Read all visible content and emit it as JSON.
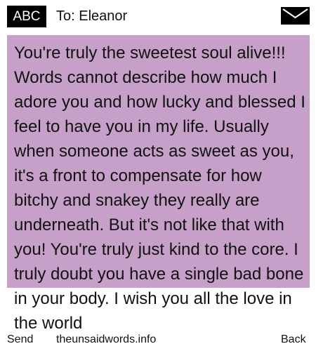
{
  "header": {
    "mode_badge": "ABC",
    "recipient_label": "To: Eleanor",
    "icon": "envelope-icon"
  },
  "message": {
    "text": "You're truly the sweetest soul alive!!! Words cannot describe how much I adore you and how lucky and blessed I feel to have you in my life. Usually when someone acts as sweet as you, it's a front to compensate for how bitchy and snakey they really are underneath. But it's not like that with you! You're truly just kind to the core. I truly doubt you have a single bad bone in your body. I wish you all the love in the world"
  },
  "footer": {
    "send_label": "Send",
    "site_label": "theunsaidwords.info",
    "back_label": "Back"
  },
  "colors": {
    "message_background": "#c6a0c9",
    "badge_background": "#000000",
    "badge_text": "#ffffff",
    "text": "#111111"
  }
}
